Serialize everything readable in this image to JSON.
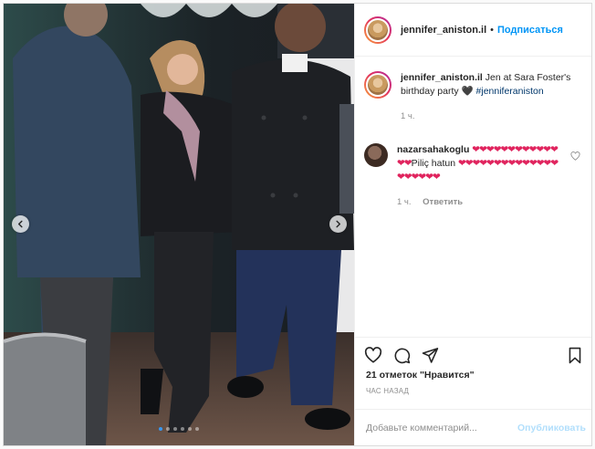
{
  "header": {
    "username": "jennifer_aniston.il",
    "separator": "•",
    "follow_label": "Подписаться"
  },
  "caption": {
    "username": "jennifer_aniston.il",
    "text": "Jen at Sara Foster's birthday party 🖤",
    "hashtag": "#jenniferaniston",
    "time": "1 ч."
  },
  "comments": [
    {
      "username": "nazarsahakoglu",
      "hearts_before": "❤❤❤❤❤❤❤❤❤❤❤❤❤❤",
      "text": "Piliç hatun",
      "hearts_after": "❤❤❤❤❤❤❤❤❤❤❤❤❤❤❤❤❤❤❤❤",
      "time": "1 ч.",
      "reply_label": "Ответить"
    }
  ],
  "likes_text": "21 отметок \"Нравится\"",
  "post_time": "ЧАС НАЗАД",
  "comment_form": {
    "placeholder": "Добавьте комментарий...",
    "publish_label": "Опубликовать"
  },
  "carousel": {
    "slide_count": 6,
    "active_index": 0
  },
  "icons": {
    "prev": "chevron-left-icon",
    "next": "chevron-right-icon",
    "like": "heart-icon",
    "comment": "comment-icon",
    "share": "share-icon",
    "save": "bookmark-icon"
  },
  "colors": {
    "link_blue": "#0095f6",
    "publish_disabled": "#b2dffc",
    "heart_red": "#e0245e"
  }
}
